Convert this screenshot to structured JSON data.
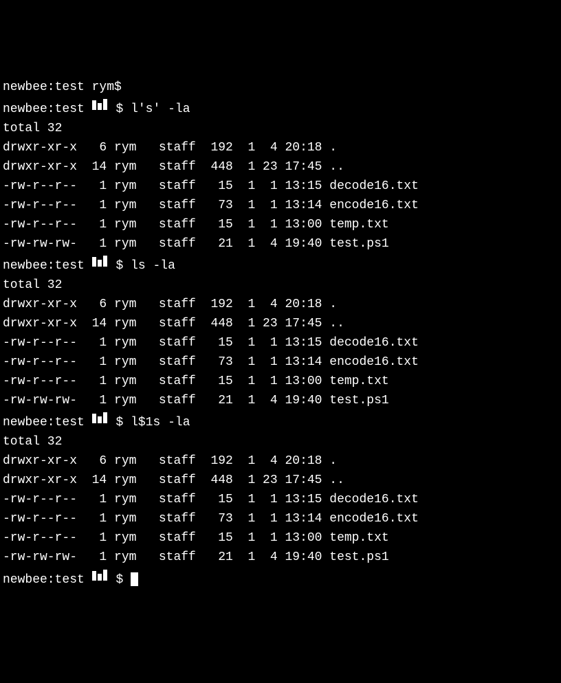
{
  "partial_top": "newbee:test rym$",
  "prompts": [
    {
      "host": "newbee:test",
      "user_obscured": true,
      "cmd": "l's' -la"
    },
    {
      "host": "newbee:test",
      "user_obscured": true,
      "cmd": "ls -la"
    },
    {
      "host": "newbee:test",
      "user_obscured": true,
      "cmd": "l$1s -la"
    },
    {
      "host": "newbee:test",
      "user_obscured": true,
      "cmd": ""
    }
  ],
  "total_line": "total 32",
  "listing": [
    {
      "perms": "drwxr-xr-x",
      "links": "6",
      "user": "rym",
      "group": "staff",
      "size": "192",
      "mon": "1",
      "day": "4",
      "time": "20:18",
      "name": "."
    },
    {
      "perms": "drwxr-xr-x",
      "links": "14",
      "user": "rym",
      "group": "staff",
      "size": "448",
      "mon": "1",
      "day": "23",
      "time": "17:45",
      "name": ".."
    },
    {
      "perms": "-rw-r--r--",
      "links": "1",
      "user": "rym",
      "group": "staff",
      "size": "15",
      "mon": "1",
      "day": "1",
      "time": "13:15",
      "name": "decode16.txt"
    },
    {
      "perms": "-rw-r--r--",
      "links": "1",
      "user": "rym",
      "group": "staff",
      "size": "73",
      "mon": "1",
      "day": "1",
      "time": "13:14",
      "name": "encode16.txt"
    },
    {
      "perms": "-rw-r--r--",
      "links": "1",
      "user": "rym",
      "group": "staff",
      "size": "15",
      "mon": "1",
      "day": "1",
      "time": "13:00",
      "name": "temp.txt"
    },
    {
      "perms": "-rw-rw-rw-",
      "links": "1",
      "user": "rym",
      "group": "staff",
      "size": "21",
      "mon": "1",
      "day": "4",
      "time": "19:40",
      "name": "test.ps1"
    }
  ]
}
